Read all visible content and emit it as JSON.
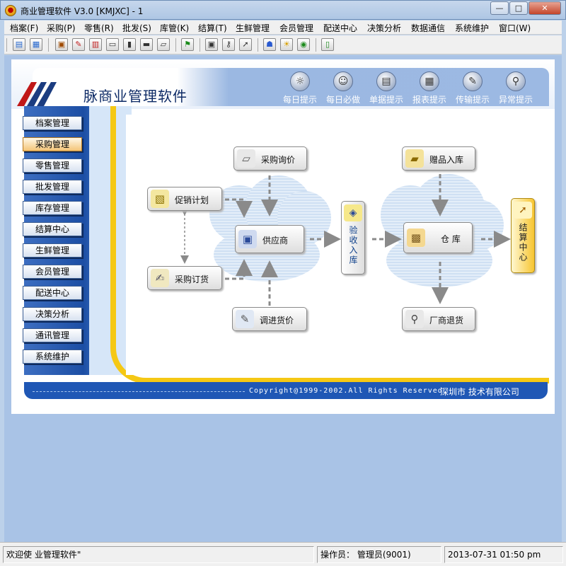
{
  "window": {
    "title": "商业管理软件 V3.0 [KMJXC] - 1",
    "app_icon_glyph": "●"
  },
  "window_controls": {
    "minimize": "—",
    "maximize": "□",
    "close": "✕"
  },
  "menu": [
    "档案(F)",
    "采购(P)",
    "零售(R)",
    "批发(S)",
    "库管(K)",
    "结算(T)",
    "生鲜管理",
    "会员管理",
    "配送中心",
    "决策分析",
    "数据通信",
    "系统维护",
    "窗口(W)"
  ],
  "toolbar_icons": [
    "new-doc-icon",
    "report-icon",
    "card-icon",
    "edit-icon",
    "calculator-icon",
    "folder-icon",
    "barcode-icon",
    "printer-icon",
    "flag-icon",
    "monitor-icon",
    "key-icon",
    "export-icon",
    "users-icon",
    "bulb-icon",
    "globe-icon",
    "exit-door-icon"
  ],
  "header": {
    "app_name": "脉商业管理软件",
    "tips": [
      {
        "label": "每日提示",
        "icon": "bulb-icon",
        "glyph": "☼"
      },
      {
        "label": "每日必做",
        "icon": "smiley-icon",
        "glyph": "☺"
      },
      {
        "label": "单据提示",
        "icon": "document-stack-icon",
        "glyph": "▤"
      },
      {
        "label": "报表提示",
        "icon": "report-icon",
        "glyph": "▦"
      },
      {
        "label": "传输提示",
        "icon": "transfer-icon",
        "glyph": "✎"
      },
      {
        "label": "异常提示",
        "icon": "magnifier-icon",
        "glyph": "⚲"
      }
    ]
  },
  "sidebar": {
    "active": "采购管理",
    "items": [
      "档案管理",
      "采购管理",
      "零售管理",
      "批发管理",
      "库存管理",
      "结算中心",
      "生鲜管理",
      "会员管理",
      "配送中心",
      "决策分析",
      "通讯管理",
      "系统维护"
    ]
  },
  "flow": {
    "purchase_inquiry": {
      "label": "采购询价",
      "glyph": "▱"
    },
    "promotion_plan": {
      "label": "促销计划",
      "glyph": "▧"
    },
    "supplier": {
      "label": "供应商",
      "glyph": "▣"
    },
    "purchase_order": {
      "label": "采购订货",
      "glyph": "✍"
    },
    "transfer_price": {
      "label": "调进货价",
      "glyph": "✎"
    },
    "receiving": {
      "label": "验收入库",
      "glyph": "◈"
    },
    "gift_stock_in": {
      "label": "赠品入库",
      "glyph": "▰"
    },
    "warehouse": {
      "label": "仓  库",
      "glyph": "▩"
    },
    "vendor_return": {
      "label": "厂商退货",
      "glyph": "⚲"
    },
    "settlement": {
      "label": "结算中心",
      "glyph": "➚"
    }
  },
  "footer": {
    "copyright": "Copyright@1999-2002.All Rights Reserved",
    "company": "深圳市      技术有限公司"
  },
  "status": {
    "welcome": "欢迎使        业管理软件\"",
    "operator": "操作员： 管理员(9001)",
    "datetime": "2013-07-31 01:50 pm"
  },
  "colors": {
    "accent_blue": "#1f57b5",
    "frame_yellow": "#f5c814",
    "active_orange": "#f4c476",
    "settlement_yellow": "#f7c531"
  }
}
